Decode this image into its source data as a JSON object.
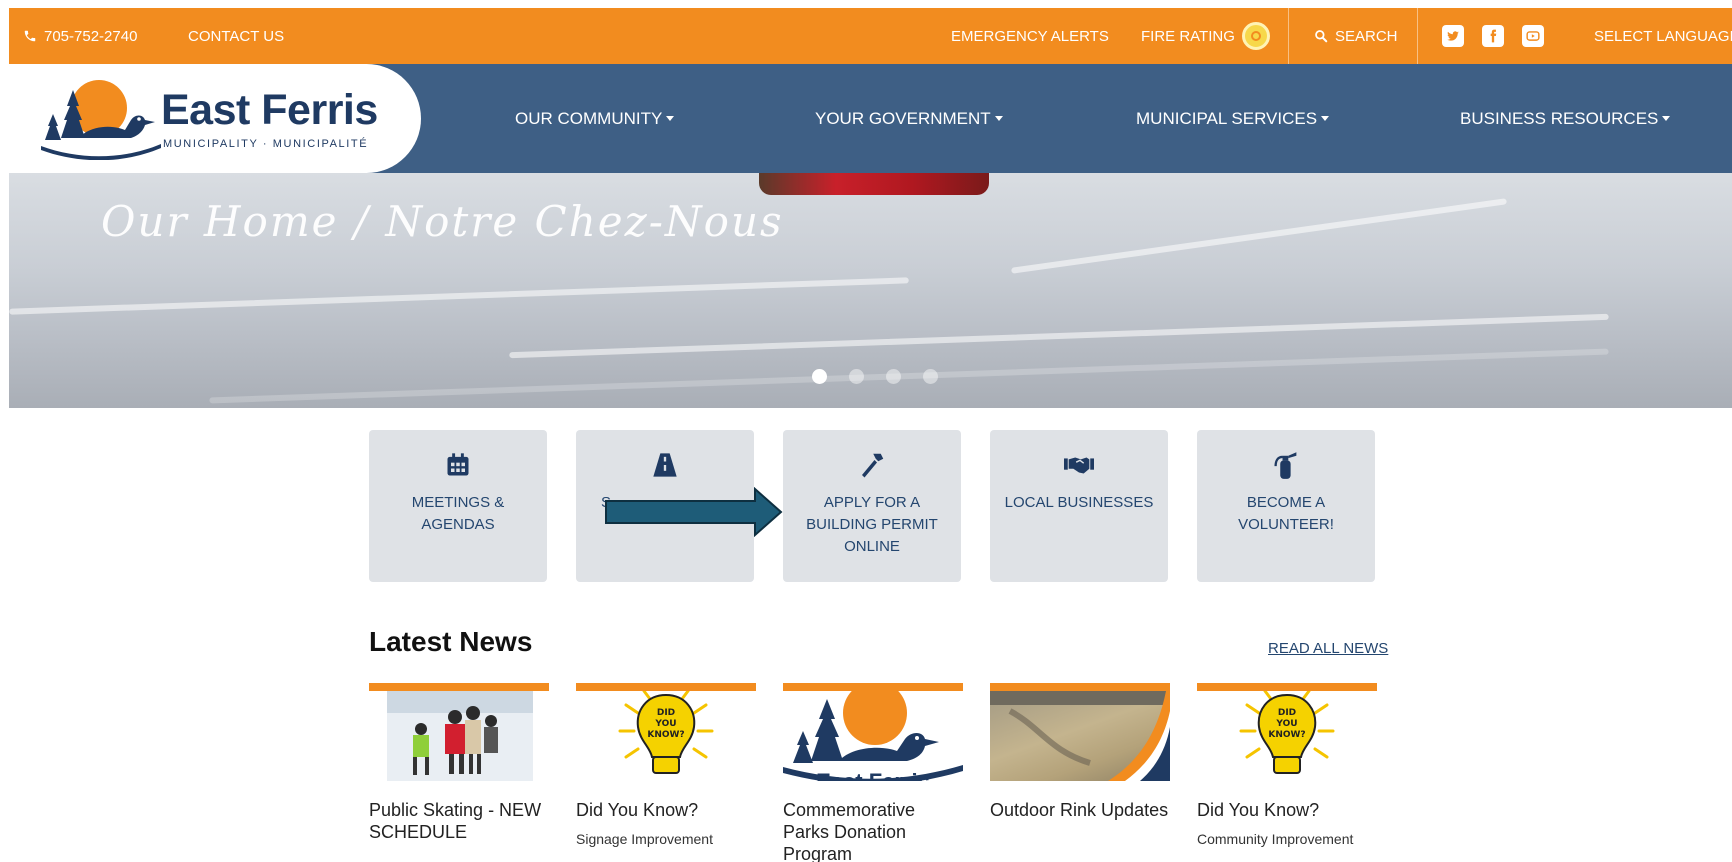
{
  "topbar": {
    "phone": "705-752-2740",
    "contact": "CONTACT US",
    "emergency": "EMERGENCY ALERTS",
    "fire_rating": "FIRE RATING",
    "search": "SEARCH",
    "language": "SELECT LANGUAGE",
    "social_icons": [
      "twitter-icon",
      "facebook-icon",
      "youtube-icon"
    ]
  },
  "brand": {
    "name": "East Ferris",
    "tagline": "MUNICIPALITY · MUNICIPALITÉ"
  },
  "nav": {
    "items": [
      {
        "label": "OUR COMMUNITY"
      },
      {
        "label": "YOUR GOVERNMENT"
      },
      {
        "label": "MUNICIPAL SERVICES"
      },
      {
        "label": "BUSINESS RESOURCES"
      }
    ]
  },
  "hero": {
    "script_title": "Our Home / Notre Chez-Nous",
    "slides": 4,
    "active_slide": 1
  },
  "quick_links": [
    {
      "label": "MEETINGS & AGENDAS",
      "icon": "calendar-icon"
    },
    {
      "label": "S",
      "icon": "road-icon"
    },
    {
      "label": "APPLY FOR A BUILDING PERMIT ONLINE",
      "icon": "hammer-icon"
    },
    {
      "label": "LOCAL BUSINESSES",
      "icon": "handshake-icon"
    },
    {
      "label": "BECOME A VOLUNTEER!",
      "icon": "fire-extinguisher-icon"
    }
  ],
  "news": {
    "heading": "Latest News",
    "read_all": "READ ALL NEWS",
    "items": [
      {
        "title": "Public Skating - NEW SCHEDULE",
        "subtitle": ""
      },
      {
        "title": "Did You Know?",
        "subtitle": "Signage Improvement"
      },
      {
        "title": "Commemorative Parks Donation Program",
        "subtitle": ""
      },
      {
        "title": "Outdoor Rink Updates",
        "subtitle": ""
      },
      {
        "title": "Did You Know?",
        "subtitle": "Community Improvement"
      }
    ],
    "bulb_text": "DID YOU KNOW?"
  },
  "colors": {
    "orange": "#f28c1f",
    "navy": "#3e5f85",
    "dark_blue": "#1f3a62",
    "card_bg": "#dfe2e6"
  }
}
